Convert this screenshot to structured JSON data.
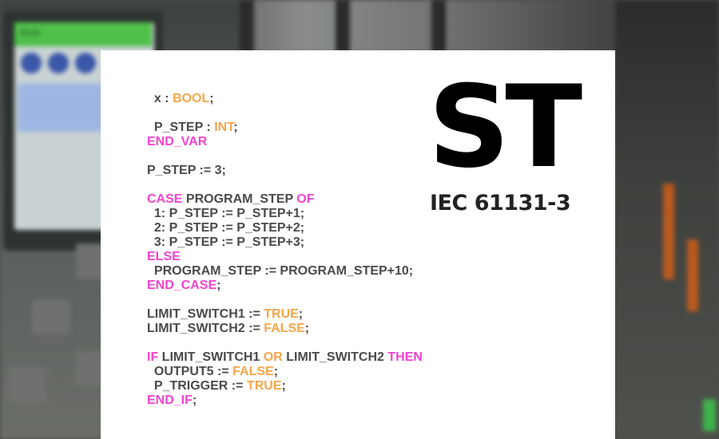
{
  "header": {
    "title": "ST",
    "subtitle": "IEC 61131-3"
  },
  "background": {
    "screen_label": "RUN"
  },
  "code": {
    "lines": [
      [
        {
          "t": "  x : ",
          "c": "plain"
        },
        {
          "t": "BOOL",
          "c": "type"
        },
        {
          "t": ";",
          "c": "plain"
        }
      ],
      [],
      [
        {
          "t": "  P_STEP : ",
          "c": "plain"
        },
        {
          "t": "INT",
          "c": "type"
        },
        {
          "t": ";",
          "c": "plain"
        }
      ],
      [
        {
          "t": "END_VAR",
          "c": "keyword"
        }
      ],
      [],
      [
        {
          "t": "P_STEP := 3;",
          "c": "plain"
        }
      ],
      [],
      [
        {
          "t": "CASE",
          "c": "keyword"
        },
        {
          "t": " PROGRAM_STEP ",
          "c": "plain"
        },
        {
          "t": "OF",
          "c": "keyword"
        }
      ],
      [
        {
          "t": "  1: P_STEP := P_STEP+1;",
          "c": "plain"
        }
      ],
      [
        {
          "t": "  2: P_STEP := P_STEP+2;",
          "c": "plain"
        }
      ],
      [
        {
          "t": "  3: P_STEP := P_STEP+3;",
          "c": "plain"
        }
      ],
      [
        {
          "t": "ELSE",
          "c": "keyword"
        }
      ],
      [
        {
          "t": "  PROGRAM_STEP := PROGRAM_STEP+10;",
          "c": "plain"
        }
      ],
      [
        {
          "t": "END_CASE",
          "c": "keyword"
        },
        {
          "t": ";",
          "c": "plain"
        }
      ],
      [],
      [
        {
          "t": "LIMIT_SWITCH1 := ",
          "c": "plain"
        },
        {
          "t": "TRUE",
          "c": "type"
        },
        {
          "t": ";",
          "c": "plain"
        }
      ],
      [
        {
          "t": "LIMIT_SWITCH2 := ",
          "c": "plain"
        },
        {
          "t": "FALSE",
          "c": "type"
        },
        {
          "t": ";",
          "c": "plain"
        }
      ],
      [],
      [
        {
          "t": "IF",
          "c": "keyword"
        },
        {
          "t": " LIMIT_SWITCH1 ",
          "c": "plain"
        },
        {
          "t": "OR",
          "c": "type"
        },
        {
          "t": " LIMIT_SWITCH2 ",
          "c": "plain"
        },
        {
          "t": "THEN",
          "c": "keyword"
        }
      ],
      [
        {
          "t": "  OUTPUT5 := ",
          "c": "plain"
        },
        {
          "t": "FALSE",
          "c": "type"
        },
        {
          "t": ";",
          "c": "plain"
        }
      ],
      [
        {
          "t": "  P_TRIGGER := ",
          "c": "plain"
        },
        {
          "t": "TRUE",
          "c": "type"
        },
        {
          "t": ";",
          "c": "plain"
        }
      ],
      [
        {
          "t": "END_IF",
          "c": "keyword"
        },
        {
          "t": ";",
          "c": "plain"
        }
      ]
    ]
  },
  "colors": {
    "keyword": "#f244cf",
    "type": "#f6a64a",
    "plain": "#4a4a4a",
    "card": "#ffffff"
  }
}
